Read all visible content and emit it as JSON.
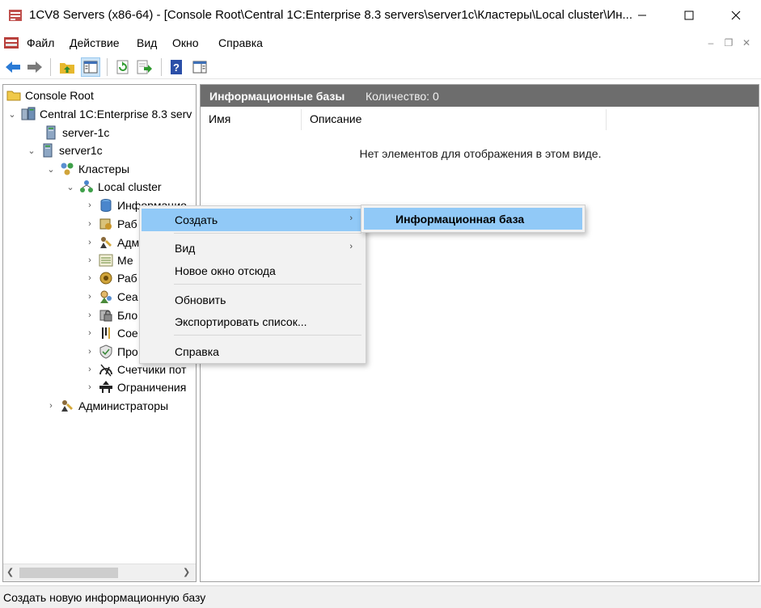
{
  "window": {
    "title": "1CV8 Servers (x86-64) - [Console Root\\Central 1C:Enterprise 8.3 servers\\server1c\\Кластеры\\Local cluster\\Ин..."
  },
  "menubar": {
    "items": [
      "Файл",
      "Действие",
      "Вид",
      "Окно",
      "Справка"
    ]
  },
  "tree": {
    "root": "Console Root",
    "central": "Central 1C:Enterprise 8.3 serv",
    "server_1c": "server-1c",
    "server1c": "server1c",
    "clusters": "Кластеры",
    "local_cluster": "Local cluster",
    "infobases": "Информацио",
    "workers": "Раб",
    "admins_short": "Адм",
    "managers": "Ме",
    "work_servers": "Раб",
    "sessions": "Сеа",
    "locks": "Бло",
    "connections": "Сое",
    "profiles": "Про",
    "counters": "Счетчики пот",
    "limits": "Ограничения",
    "administrators": "Администраторы"
  },
  "result": {
    "title": "Информационные базы",
    "count": "Количество: 0",
    "columns": [
      "Имя",
      "Описание"
    ],
    "empty_message": "Нет элементов для отображения в этом виде."
  },
  "context_menu": {
    "create": "Создать",
    "view": "Вид",
    "new_window": "Новое окно отсюда",
    "refresh": "Обновить",
    "export": "Экспортировать список...",
    "help": "Справка"
  },
  "submenu": {
    "infobase": "Информационная база"
  },
  "statusbar": {
    "text": "Создать новую информационную базу"
  }
}
